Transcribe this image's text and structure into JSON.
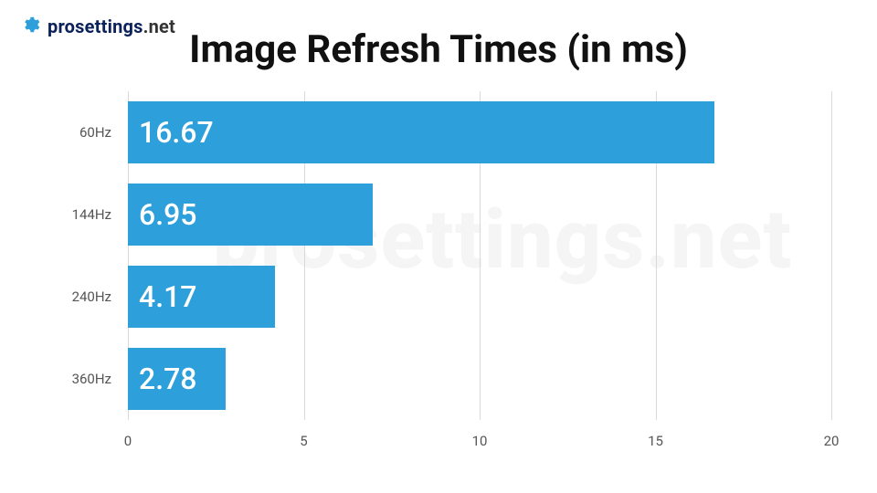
{
  "brand": {
    "pro": "prosettings",
    "dotnet": ".net"
  },
  "title": "Image Refresh Times (in ms)",
  "watermark": "prosettings.net",
  "chart_data": {
    "type": "bar",
    "orientation": "horizontal",
    "categories": [
      "60Hz",
      "144Hz",
      "240Hz",
      "360Hz"
    ],
    "values": [
      16.67,
      6.95,
      4.17,
      2.78
    ],
    "xlabel": "",
    "ylabel": "",
    "xlim": [
      0,
      20
    ],
    "xticks": [
      0,
      5,
      10,
      15,
      20
    ],
    "bar_color": "#2da0dc",
    "title": "Image Refresh Times (in ms)"
  }
}
